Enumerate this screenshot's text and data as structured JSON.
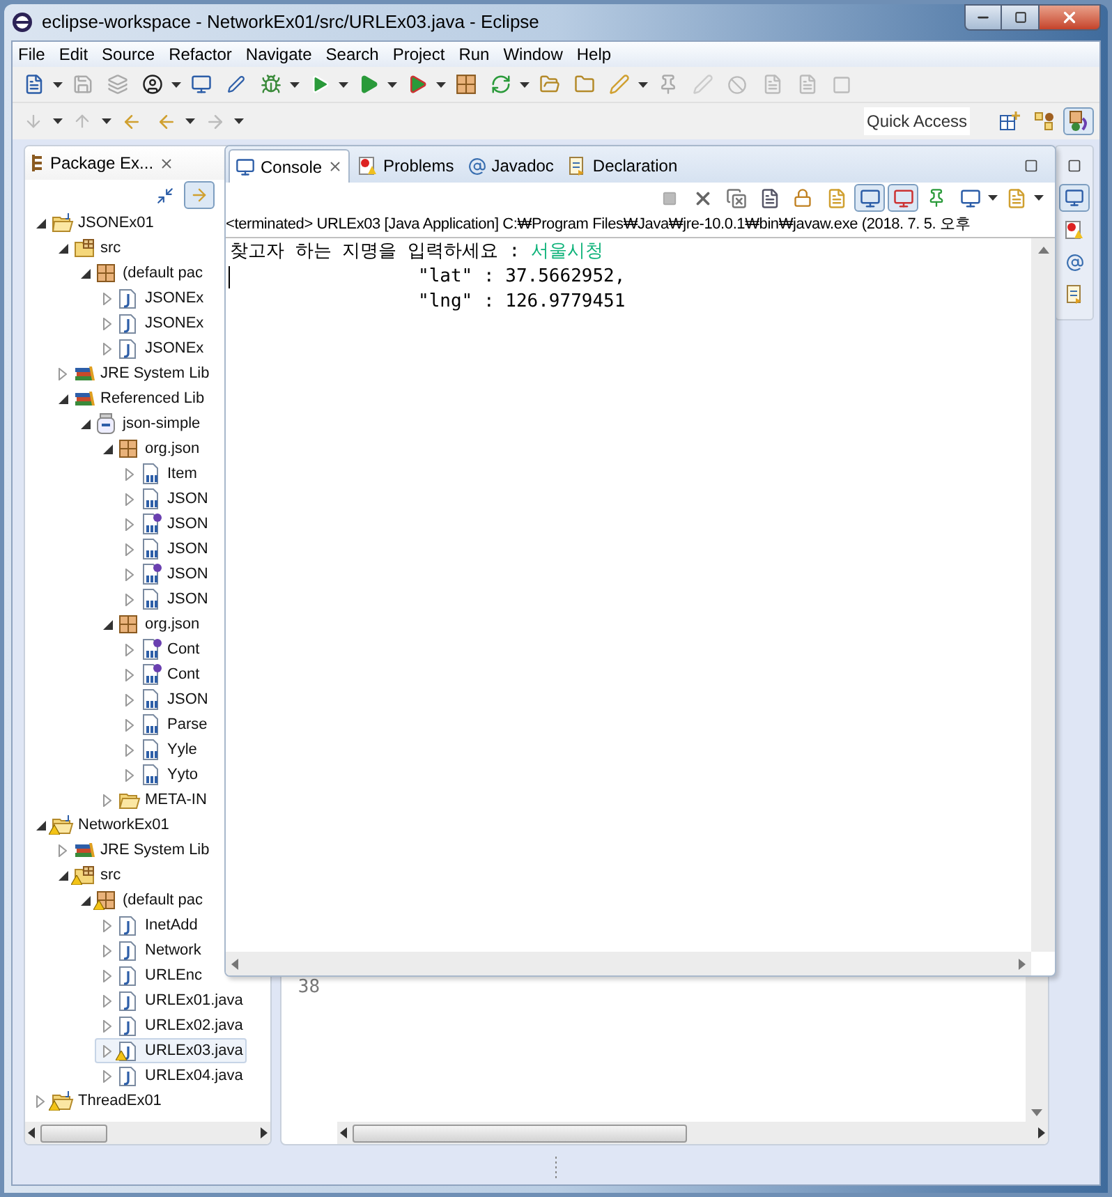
{
  "window": {
    "title": "eclipse-workspace - NetworkEx01/src/URLEx03.java - Eclipse"
  },
  "menu": [
    "File",
    "Edit",
    "Source",
    "Refactor",
    "Navigate",
    "Search",
    "Project",
    "Run",
    "Window",
    "Help"
  ],
  "quick_access": {
    "placeholder": "Quick Access"
  },
  "perspectives": [
    {
      "kind": "open",
      "selected": false
    },
    {
      "kind": "resource",
      "selected": false
    },
    {
      "kind": "java",
      "selected": true
    }
  ],
  "package_explorer": {
    "title": "Package Ex...",
    "link_with_editor": true,
    "tree": [
      {
        "label": "JSONEx01",
        "kind": "project",
        "expanded": true,
        "warning": false,
        "selected": false,
        "children": [
          {
            "label": "src",
            "kind": "source-folder",
            "expanded": true,
            "warning": false,
            "selected": false,
            "children": [
              {
                "label": "(default pac",
                "kind": "package",
                "expanded": true,
                "warning": false,
                "selected": false,
                "children": [
                  {
                    "label": "JSONEx",
                    "kind": "java-file",
                    "expanded": false,
                    "warning": false,
                    "selected": false
                  },
                  {
                    "label": "JSONEx",
                    "kind": "java-file",
                    "expanded": false,
                    "warning": false,
                    "selected": false
                  },
                  {
                    "label": "JSONEx",
                    "kind": "java-file",
                    "expanded": false,
                    "warning": false,
                    "selected": false
                  }
                ]
              }
            ]
          },
          {
            "label": "JRE System Lib",
            "kind": "library",
            "expanded": false,
            "warning": false,
            "selected": false
          },
          {
            "label": "Referenced Lib",
            "kind": "library",
            "expanded": true,
            "warning": false,
            "selected": false,
            "children": [
              {
                "label": "json-simple",
                "kind": "jar",
                "expanded": true,
                "warning": false,
                "selected": false,
                "children": [
                  {
                    "label": "org.json",
                    "kind": "package",
                    "expanded": true,
                    "warning": false,
                    "selected": false,
                    "children": [
                      {
                        "label": "Item",
                        "kind": "class-file",
                        "expanded": false,
                        "warning": false,
                        "selected": false
                      },
                      {
                        "label": "JSON",
                        "kind": "class-file",
                        "expanded": false,
                        "warning": false,
                        "selected": false
                      },
                      {
                        "label": "JSON",
                        "kind": "interface-file",
                        "expanded": false,
                        "warning": false,
                        "selected": false
                      },
                      {
                        "label": "JSON",
                        "kind": "class-file",
                        "expanded": false,
                        "warning": false,
                        "selected": false
                      },
                      {
                        "label": "JSON",
                        "kind": "interface-file",
                        "expanded": false,
                        "warning": false,
                        "selected": false
                      },
                      {
                        "label": "JSON",
                        "kind": "class-file",
                        "expanded": false,
                        "warning": false,
                        "selected": false
                      }
                    ]
                  },
                  {
                    "label": "org.json",
                    "kind": "package",
                    "expanded": true,
                    "warning": false,
                    "selected": false,
                    "children": [
                      {
                        "label": "Cont",
                        "kind": "interface-file",
                        "expanded": false,
                        "warning": false,
                        "selected": false
                      },
                      {
                        "label": "Cont",
                        "kind": "interface-file",
                        "expanded": false,
                        "warning": false,
                        "selected": false
                      },
                      {
                        "label": "JSON",
                        "kind": "class-file",
                        "expanded": false,
                        "warning": false,
                        "selected": false
                      },
                      {
                        "label": "Parse",
                        "kind": "class-file",
                        "expanded": false,
                        "warning": false,
                        "selected": false
                      },
                      {
                        "label": "Yyle",
                        "kind": "class-file",
                        "expanded": false,
                        "warning": false,
                        "selected": false
                      },
                      {
                        "label": "Yyto",
                        "kind": "class-file",
                        "expanded": false,
                        "warning": false,
                        "selected": false
                      }
                    ]
                  },
                  {
                    "label": "META-IN",
                    "kind": "folder",
                    "expanded": false,
                    "warning": false,
                    "selected": false
                  }
                ]
              }
            ]
          }
        ]
      },
      {
        "label": "NetworkEx01",
        "kind": "project",
        "expanded": true,
        "warning": true,
        "selected": false,
        "children": [
          {
            "label": "JRE System Lib",
            "kind": "library",
            "expanded": false,
            "warning": false,
            "selected": false
          },
          {
            "label": "src",
            "kind": "source-folder",
            "expanded": true,
            "warning": true,
            "selected": false,
            "children": [
              {
                "label": "(default pac",
                "kind": "package",
                "expanded": true,
                "warning": true,
                "selected": false,
                "children": [
                  {
                    "label": "InetAdd",
                    "kind": "java-file",
                    "expanded": false,
                    "warning": false,
                    "selected": false
                  },
                  {
                    "label": "Network",
                    "kind": "java-file",
                    "expanded": false,
                    "warning": false,
                    "selected": false
                  },
                  {
                    "label": "URLEnc",
                    "kind": "java-file",
                    "expanded": false,
                    "warning": false,
                    "selected": false
                  },
                  {
                    "label": "URLEx01.java",
                    "kind": "java-file",
                    "expanded": false,
                    "warning": false,
                    "selected": false
                  },
                  {
                    "label": "URLEx02.java",
                    "kind": "java-file",
                    "expanded": false,
                    "warning": false,
                    "selected": false
                  },
                  {
                    "label": "URLEx03.java",
                    "kind": "java-file",
                    "expanded": false,
                    "warning": true,
                    "selected": true
                  },
                  {
                    "label": "URLEx04.java",
                    "kind": "java-file",
                    "expanded": false,
                    "warning": false,
                    "selected": false
                  }
                ]
              }
            ]
          }
        ]
      },
      {
        "label": "ThreadEx01",
        "kind": "project",
        "expanded": false,
        "warning": true,
        "selected": false
      }
    ]
  },
  "console": {
    "tabs": [
      {
        "label": "Console",
        "kind": "console",
        "selected": true
      },
      {
        "label": "Problems",
        "kind": "problems",
        "selected": false
      },
      {
        "label": "Javadoc",
        "kind": "javadoc",
        "selected": false
      },
      {
        "label": "Declaration",
        "kind": "declaration",
        "selected": false
      }
    ],
    "toggles": [
      {
        "kind": "stdout",
        "pressed": true
      },
      {
        "kind": "stderr",
        "pressed": true
      }
    ],
    "status": "<terminated> URLEx03 [Java Application] C:₩Program Files₩Java₩jre-10.0.1₩bin₩javaw.exe (2018. 7. 5. 오후",
    "lines": [
      {
        "kind": "prompt",
        "text": "찾고자 하는 지명을 입력하세요 : ",
        "input": "서울시청"
      },
      {
        "kind": "value",
        "text": "\"lat\" : 37.5662952,"
      },
      {
        "kind": "value",
        "text": "\"lng\" : 126.9779451"
      }
    ]
  },
  "editor": {
    "line_numbers": [
      "38"
    ]
  },
  "trim_views": [
    {
      "kind": "console",
      "selected": true
    },
    {
      "kind": "problems",
      "selected": false
    },
    {
      "kind": "javadoc",
      "selected": false
    },
    {
      "kind": "declaration",
      "selected": false
    }
  ]
}
